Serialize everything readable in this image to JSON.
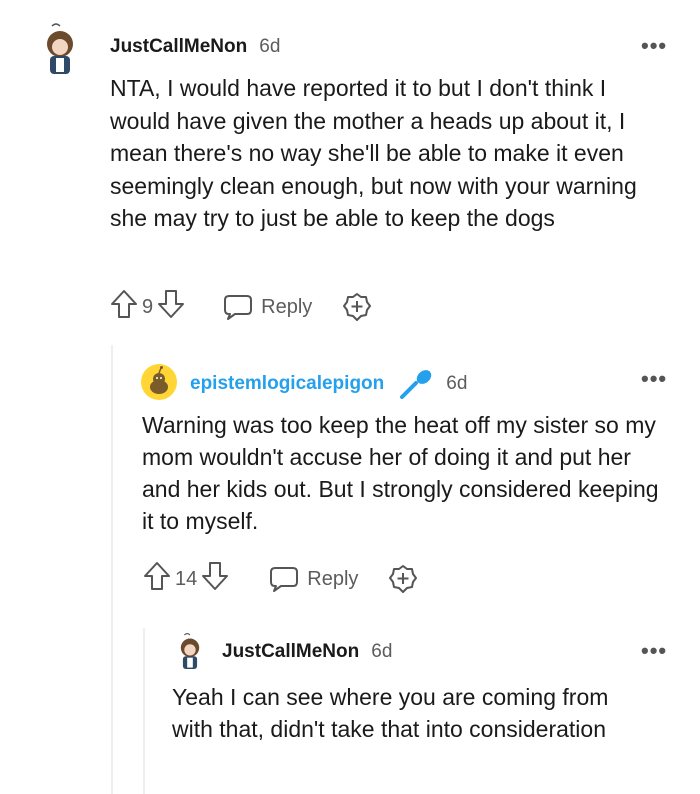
{
  "comments": [
    {
      "author": "JustCallMeNon",
      "age": "6d",
      "text": "NTA, I would have reported it to but I don't think I would have given the mother a heads up about it, I mean there's no way she'll be able to make it even seemingly clean enough, but now with your warning she may try to just be able to keep the dogs",
      "votes": "9",
      "reply_label": "Reply",
      "more": "•••"
    },
    {
      "author": "epistemlogicalepigon",
      "age": "6d",
      "text": "Warning was too keep the heat off my sister so my mom wouldn't accuse her of doing it and put her and her kids out. But I strongly considered keeping it to myself.",
      "votes": "14",
      "reply_label": "Reply",
      "more": "•••"
    },
    {
      "author": "JustCallMeNon",
      "age": "6d",
      "text": "Yeah I can see where you are coming from with that, didn't take that into consideration",
      "more": "•••"
    }
  ],
  "colors": {
    "op_author": "#24a0ed",
    "thread_line": "#edeff1",
    "muted": "#5c5c5c"
  }
}
